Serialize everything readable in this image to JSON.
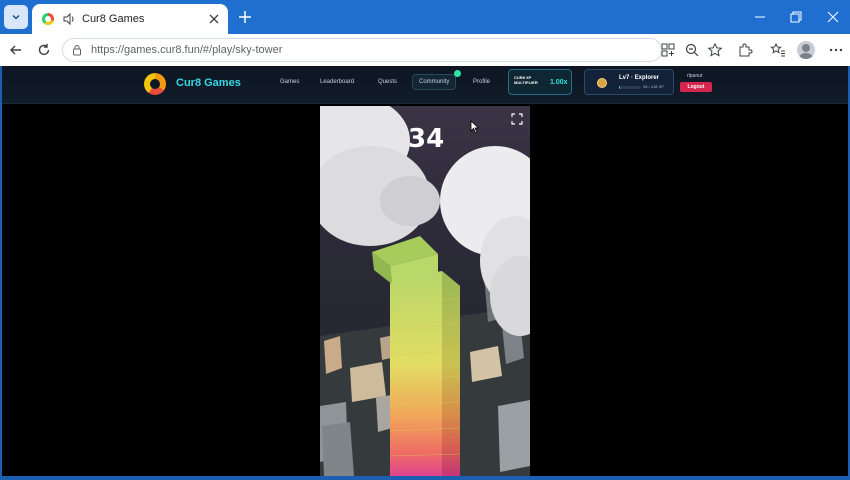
{
  "browser": {
    "tab_title": "Cur8 Games",
    "url": "https://games.cur8.fun/#/play/sky-tower"
  },
  "site": {
    "brand": "Cur8 Games",
    "nav": [
      "Games",
      "Leaderboard",
      "Quests",
      "Community",
      "Profile"
    ],
    "xp_multiplier_label": "CUR8 XP MULTIPLIER",
    "xp_multiplier_value": "1.00x",
    "level_text": "Lv7 · Explorer",
    "xp_progress": "26 / 418 XP",
    "xp_fraction": 0.06,
    "username": "rlpanur",
    "logout_label": "Logout"
  },
  "game": {
    "score": "34"
  },
  "colors": {
    "browser_blue": "#1f6fd0",
    "brand_cyan": "#38d6e6",
    "logout_red": "#d7264e"
  }
}
